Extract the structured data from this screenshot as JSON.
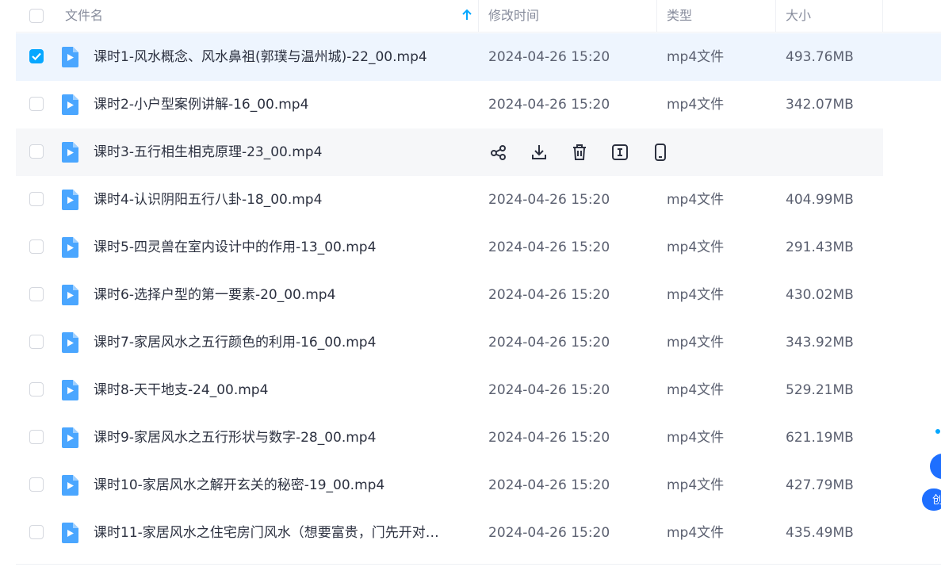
{
  "header": {
    "name": "文件名",
    "modified": "修改时间",
    "type": "类型",
    "size": "大小"
  },
  "colors": {
    "accent": "#06a7ff",
    "selected_row": "#eef5fe",
    "hover_row": "#f6f7f9"
  },
  "hover_actions": [
    "share-icon",
    "download-icon",
    "delete-icon",
    "rename-icon",
    "mobile-icon"
  ],
  "files": [
    {
      "name": "课时1-风水概念、风水鼻祖(郭璞与温州城)-22_00.mp4",
      "date": "2024-04-26 15:20",
      "type": "mp4文件",
      "size": "493.76MB",
      "checked": true
    },
    {
      "name": "课时2-小户型案例讲解-16_00.mp4",
      "date": "2024-04-26 15:20",
      "type": "mp4文件",
      "size": "342.07MB",
      "checked": false
    },
    {
      "name": "课时3-五行相生相克原理-23_00.mp4",
      "date": "",
      "type": "",
      "size": "",
      "checked": false,
      "hover": true
    },
    {
      "name": "课时4-认识阴阳五行八卦-18_00.mp4",
      "date": "2024-04-26 15:20",
      "type": "mp4文件",
      "size": "404.99MB",
      "checked": false
    },
    {
      "name": "课时5-四灵兽在室内设计中的作用-13_00.mp4",
      "date": "2024-04-26 15:20",
      "type": "mp4文件",
      "size": "291.43MB",
      "checked": false
    },
    {
      "name": "课时6-选择户型的第一要素-20_00.mp4",
      "date": "2024-04-26 15:20",
      "type": "mp4文件",
      "size": "430.02MB",
      "checked": false
    },
    {
      "name": "课时7-家居风水之五行颜色的利用-16_00.mp4",
      "date": "2024-04-26 15:20",
      "type": "mp4文件",
      "size": "343.92MB",
      "checked": false
    },
    {
      "name": "课时8-天干地支-24_00.mp4",
      "date": "2024-04-26 15:20",
      "type": "mp4文件",
      "size": "529.21MB",
      "checked": false
    },
    {
      "name": "课时9-家居风水之五行形状与数字-28_00.mp4",
      "date": "2024-04-26 15:20",
      "type": "mp4文件",
      "size": "621.19MB",
      "checked": false
    },
    {
      "name": "课时10-家居风水之解开玄关的秘密-19_00.mp4",
      "date": "2024-04-26 15:20",
      "type": "mp4文件",
      "size": "427.79MB",
      "checked": false
    },
    {
      "name": "课时11-家居风水之住宅房门风水（想要富贵，门先开对…",
      "date": "2024-04-26 15:20",
      "type": "mp4文件",
      "size": "435.49MB",
      "checked": false
    }
  ],
  "float_widget": {
    "label": "创"
  }
}
